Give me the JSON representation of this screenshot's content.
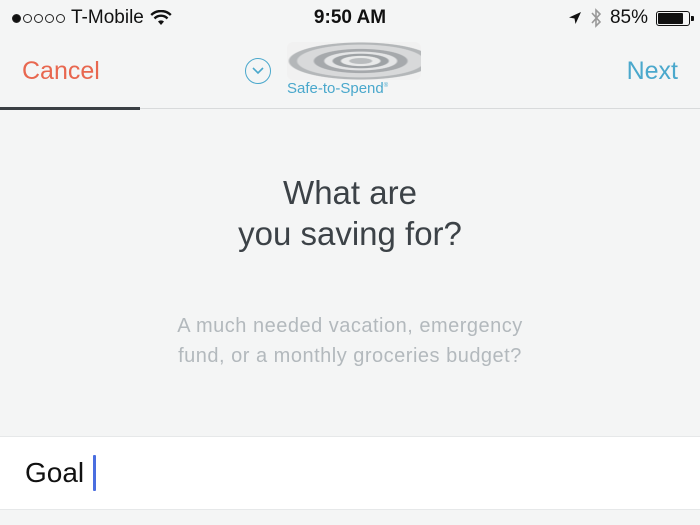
{
  "status_bar": {
    "signal_bars_filled": 1,
    "signal_bars_total": 5,
    "carrier": "T-Mobile",
    "wifi_icon": "wifi-icon",
    "time": "9:50 AM",
    "location_icon": "location-arrow-icon",
    "bluetooth_icon": "bluetooth-icon",
    "battery_percent_text": "85%",
    "battery_level": 0.85
  },
  "nav": {
    "cancel_label": "Cancel",
    "next_label": "Next",
    "brand_name": "Safe-to-Spend",
    "brand_mark": "®",
    "dropdown_icon": "chevron-down-circle-icon",
    "colors": {
      "cancel": "#e8674f",
      "next": "#4aa8cc",
      "brand": "#4aa8cc"
    }
  },
  "content": {
    "title_line1": "What are",
    "title_line2": "you saving for?",
    "subtitle_line1": "A much needed vacation, emergency",
    "subtitle_line2": "fund, or a monthly groceries budget?"
  },
  "goal_field": {
    "value": "Goal",
    "caret_color": "#4a6ee0"
  }
}
